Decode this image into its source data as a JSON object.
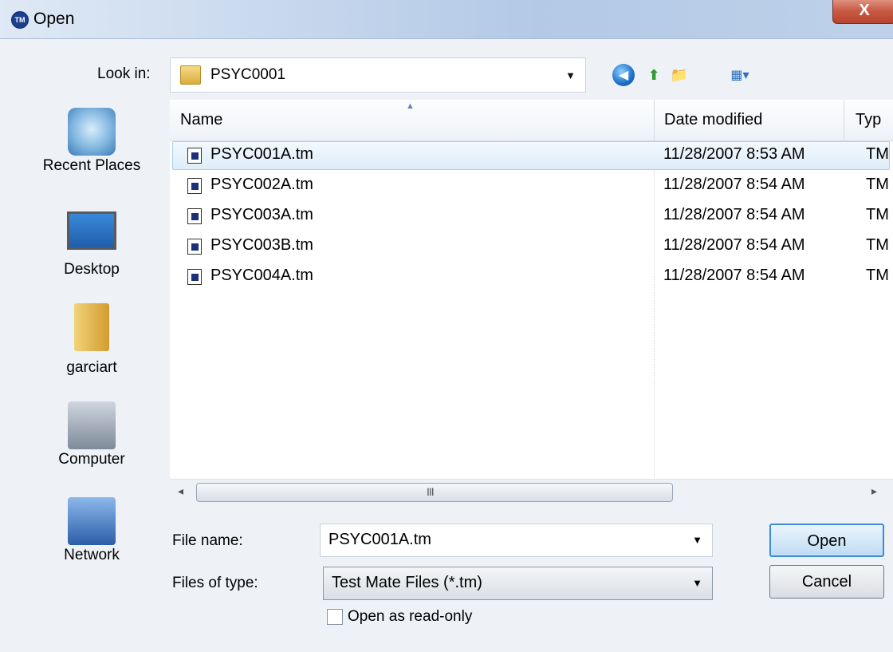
{
  "window": {
    "title": "Open",
    "app_icon_text": "TM",
    "close_label": "X"
  },
  "look_in": {
    "label": "Look in:",
    "value": "PSYC0001"
  },
  "toolbar": {
    "icons": [
      "back-icon",
      "up-folder-icon",
      "new-folder-icon",
      "views-menu-icon"
    ]
  },
  "places": [
    {
      "label": "Recent Places",
      "icon": "recent-places-icon"
    },
    {
      "label": "Desktop",
      "icon": "desktop-icon"
    },
    {
      "label": "garciart",
      "icon": "user-folder-icon"
    },
    {
      "label": "Computer",
      "icon": "computer-icon"
    },
    {
      "label": "Network",
      "icon": "network-icon"
    }
  ],
  "file_list": {
    "columns": [
      "Name",
      "Date modified",
      "Typ"
    ],
    "rows": [
      {
        "name": "PSYC001A.tm",
        "date": "11/28/2007 8:53 AM",
        "type": "TM",
        "selected": true
      },
      {
        "name": "PSYC002A.tm",
        "date": "11/28/2007 8:54 AM",
        "type": "TM",
        "selected": false
      },
      {
        "name": "PSYC003A.tm",
        "date": "11/28/2007 8:54 AM",
        "type": "TM",
        "selected": false
      },
      {
        "name": "PSYC003B.tm",
        "date": "11/28/2007 8:54 AM",
        "type": "TM",
        "selected": false
      },
      {
        "name": "PSYC004A.tm",
        "date": "11/28/2007 8:54 AM",
        "type": "TM",
        "selected": false
      }
    ]
  },
  "scrollbar": {
    "left_arrow": "◂",
    "right_arrow": "▸",
    "grip": "III"
  },
  "file_name": {
    "label": "File name:",
    "value": "PSYC001A.tm"
  },
  "file_type": {
    "label": "Files of type:",
    "value": "Test Mate Files (*.tm)"
  },
  "read_only": {
    "label": "Open as read-only",
    "checked": false
  },
  "buttons": {
    "open": "Open",
    "cancel": "Cancel"
  },
  "colors": {
    "selection": "#deedf9",
    "selection_border": "#a9cfef",
    "default_button_border": "#3b8bd7"
  }
}
